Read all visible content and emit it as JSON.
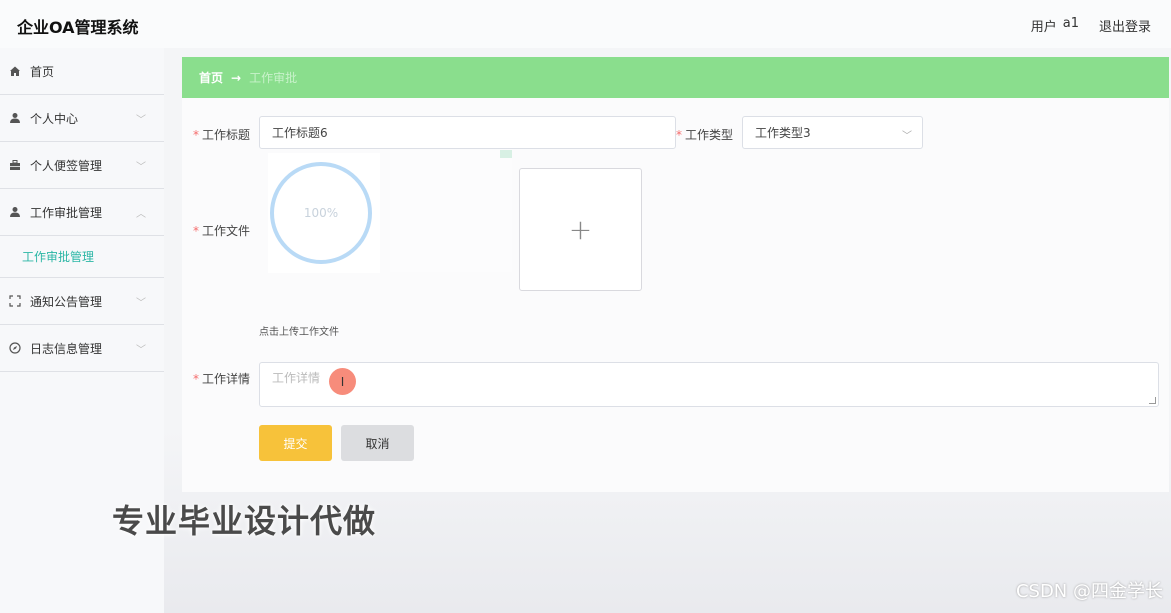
{
  "header": {
    "app_title": "企业OA管理系统",
    "user_label": "用户",
    "username": "a1",
    "logout_label": "退出登录"
  },
  "sidebar": {
    "items": [
      {
        "label": "首页",
        "icon": "home-icon"
      },
      {
        "label": "个人中心",
        "icon": "user-icon"
      },
      {
        "label": "个人便签管理",
        "icon": "briefcase-icon"
      },
      {
        "label": "工作审批管理",
        "icon": "user-icon",
        "expanded": true
      },
      {
        "label": "通知公告管理",
        "icon": "frame-icon"
      },
      {
        "label": "日志信息管理",
        "icon": "compass-icon"
      }
    ],
    "submenu_active": "工作审批管理"
  },
  "breadcrumb": {
    "home": "首页",
    "separator": "→",
    "current": "工作审批"
  },
  "form": {
    "title_label": "工作标题",
    "title_value": "工作标题6",
    "type_label": "工作类型",
    "type_value": "工作类型3",
    "file_label": "工作文件",
    "upload_progress": "100%",
    "upload_plus": "+",
    "upload_hint": "点击上传工作文件",
    "detail_label": "工作详情",
    "detail_placeholder": "工作详情"
  },
  "buttons": {
    "submit": "提交",
    "cancel": "取消"
  },
  "overlay": {
    "caption": "专业毕业设计代做",
    "watermark": "CSDN @四金学长",
    "cursor_glyph": "I"
  },
  "colors": {
    "breadcrumb_bg": "#8ade8d",
    "accent_teal": "#2bb6a5",
    "submit_bg": "#f7c23a",
    "required": "#f56c6c"
  }
}
